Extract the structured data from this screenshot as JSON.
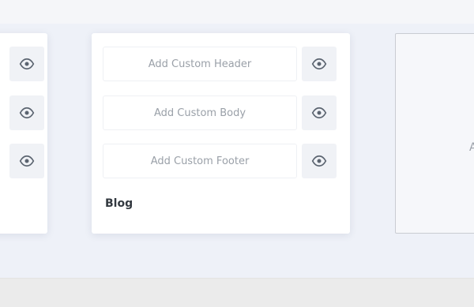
{
  "layouts": [
    {
      "slots": [
        "",
        "",
        ""
      ],
      "preview_icon": "eye-icon"
    },
    {
      "title": "Blog",
      "slots": [
        "Add Custom Header",
        "Add Custom Body",
        "Add Custom Footer"
      ],
      "preview_icon": "eye-icon"
    }
  ],
  "new_layout": {
    "label_partial": "A"
  }
}
